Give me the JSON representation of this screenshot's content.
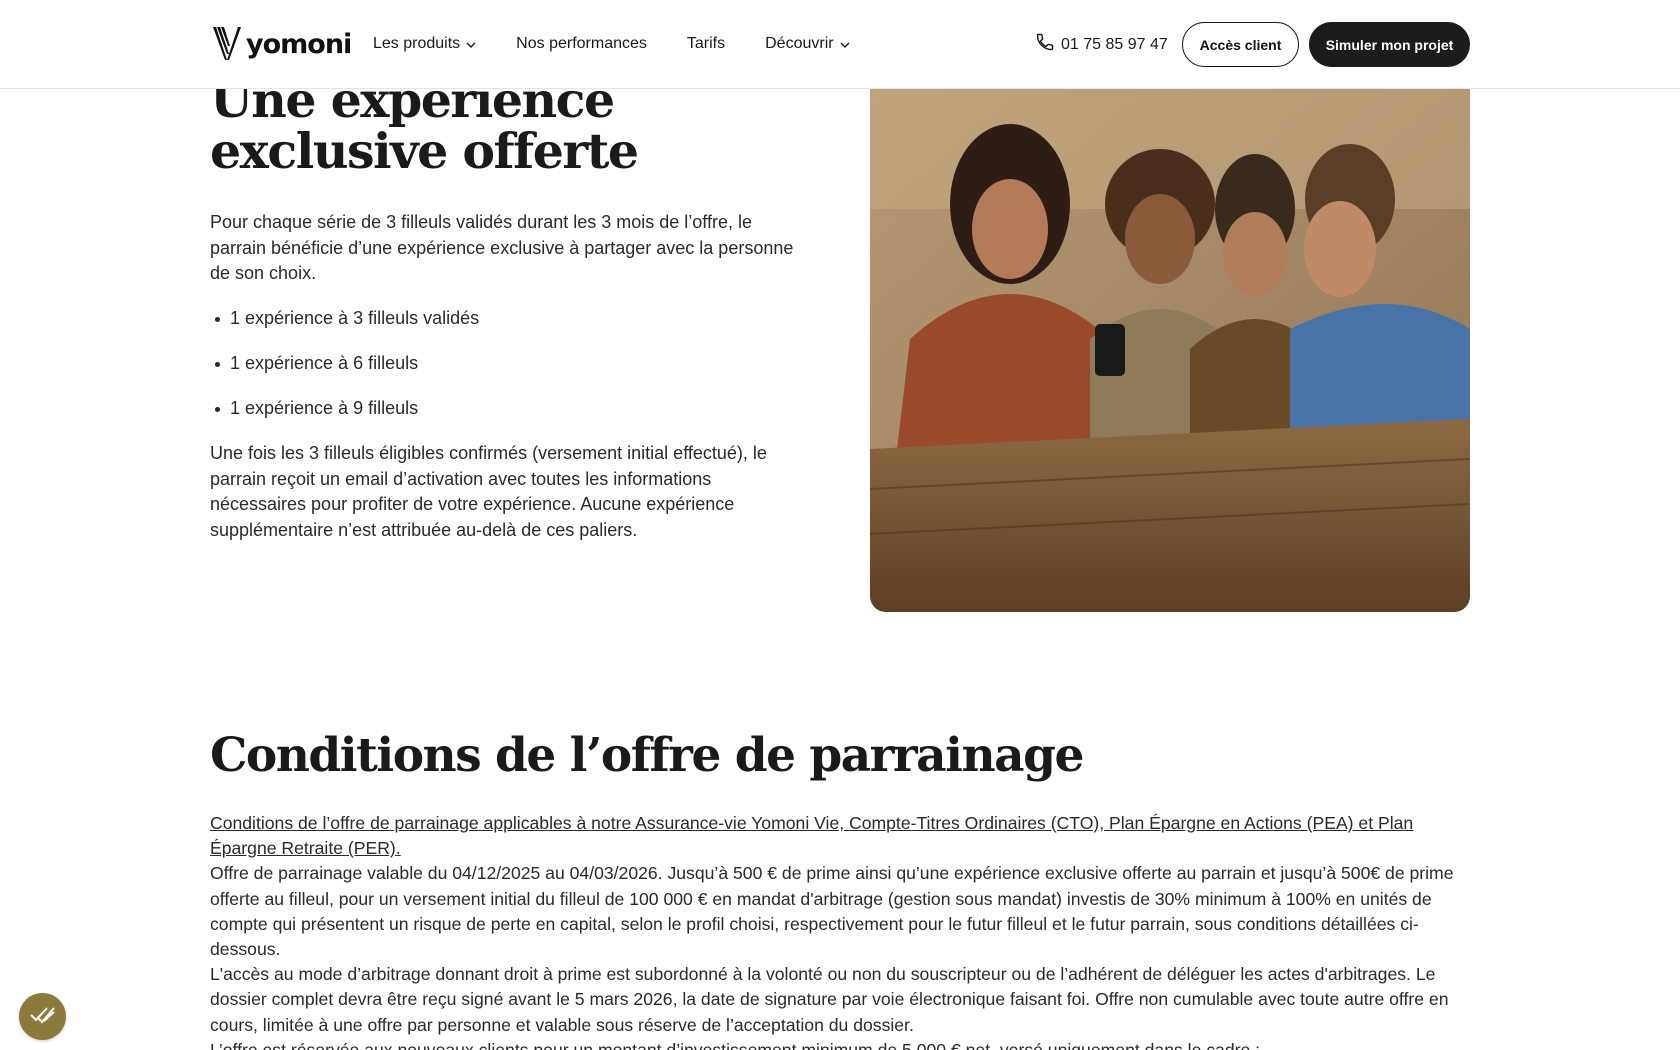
{
  "header": {
    "logo_text": "yomoni",
    "nav": [
      {
        "label": "Les produits",
        "has_dropdown": true
      },
      {
        "label": "Nos performances",
        "has_dropdown": false
      },
      {
        "label": "Tarifs",
        "has_dropdown": false
      },
      {
        "label": "Découvrir",
        "has_dropdown": true
      }
    ],
    "phone": "01 75 85 97 47",
    "client_button": "Accès client",
    "simulate_button": "Simuler mon projet",
    "icons": {
      "phone": "phone-icon",
      "dropdown": "chevron-down-icon"
    }
  },
  "experience": {
    "title": "Une expérience exclusive offerte",
    "intro": "Pour chaque série de 3 filleuls validés durant les 3 mois de l’offre, le parrain bénéficie d’une expérience exclusive à partager avec la personne de son choix.",
    "bullets": [
      "1 expérience à 3 filleuls validés",
      "1 expérience à 6 filleuls",
      "1 expérience à 9 filleuls"
    ],
    "outro": "Une fois les 3 filleuls éligibles confirmés (versement initial effectué), le parrain reçoit un email d’activation avec toutes les informations nécessaires pour profiter de votre expérience. Aucune expérience supplémentaire n’est attribuée au-delà de ces paliers."
  },
  "conditions": {
    "title": "Conditions de l’offre de parrainage",
    "link": "Conditions de l’offre de parrainage applicables à notre Assurance-vie Yomoni Vie, Compte-Titres Ordinaires (CTO), Plan Épargne en Actions (PEA) et Plan Épargne Retraite (PER).",
    "paragraph1": "Offre de parrainage valable du 04/12/2025 au 04/03/2026. Jusqu’à 500 € de prime ainsi qu’une expérience exclusive offerte au parrain et jusqu’à 500€ de prime offerte au filleul, pour un versement initial du filleul de 100 000 € en mandat d'arbitrage (gestion sous mandat) investis de 30% minimum à 100% en unités de compte qui présentent un risque de perte en capital, selon le profil choisi, respectivement pour le futur filleul et le futur parrain, sous conditions détaillées ci-dessous.",
    "paragraph2": "L'accès au mode d’arbitrage donnant droit à prime est subordonné à la volonté ou non du souscripteur ou de l’adhérent de déléguer les actes d'arbitrages. Le dossier complet devra être reçu signé avant le 5 mars 2026, la date de signature par voie électronique faisant foi. Offre non cumulable avec toute autre offre en cours, limitée à une offre par personne et valable sous réserve de l’acceptation du dossier.",
    "paragraph3": "L’offre est réservée aux nouveaux clients pour un montant d’investissement minimum de 5 000 € net, versé uniquement dans le cadre :"
  },
  "colors": {
    "text": "#1f1f1f",
    "primary_button": "#1c1c1c",
    "cookie_button": "#8c7a3c",
    "border": "#e4e4e4"
  },
  "cookie": {
    "icon": "cookie-consent-icon"
  }
}
